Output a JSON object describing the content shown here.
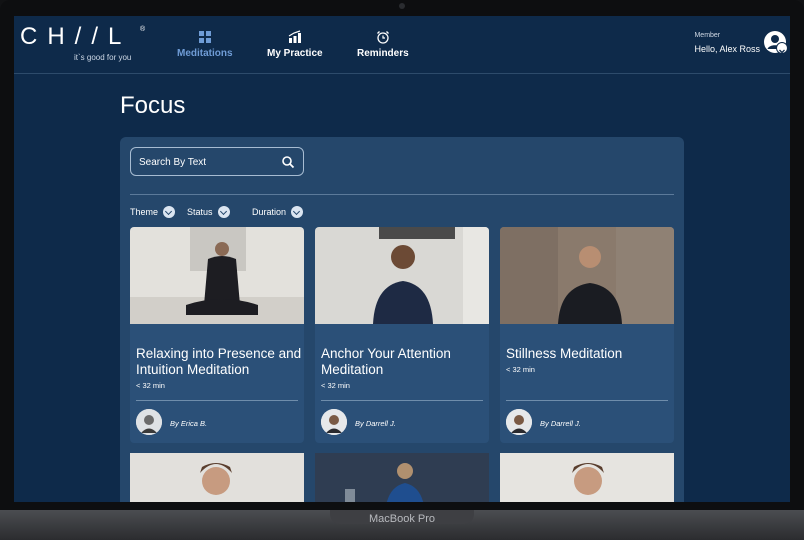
{
  "device": {
    "label": "MacBook Pro"
  },
  "brand": {
    "logo": "CH//L",
    "registered": "®",
    "tagline": "it`s good for you"
  },
  "nav": {
    "items": [
      {
        "label": "Meditations",
        "icon": "grid-icon"
      },
      {
        "label": "My Practice",
        "icon": "chart-icon"
      },
      {
        "label": "Reminders",
        "icon": "alarm-clock-icon"
      }
    ]
  },
  "member": {
    "role": "Member",
    "greeting": "Hello, Alex Ross"
  },
  "page": {
    "title": "Focus"
  },
  "search": {
    "placeholder": "Search By Text"
  },
  "filters": [
    "Theme",
    "Status",
    "Duration"
  ],
  "cards": [
    {
      "title": "Relaxing into Presence and Intuition Meditation",
      "duration": "< 32 min",
      "author": "By Erica B."
    },
    {
      "title": "Anchor Your Attention Meditation",
      "duration": "< 32 min",
      "author": "By Darrell J."
    },
    {
      "title": "Stillness Meditation",
      "duration": "< 32 min",
      "author": "By Darrell J."
    }
  ],
  "colors": {
    "background": "#0e2a4a",
    "panel": "#25476b",
    "card": "#2b5078",
    "accent": "#6f9cd6"
  }
}
